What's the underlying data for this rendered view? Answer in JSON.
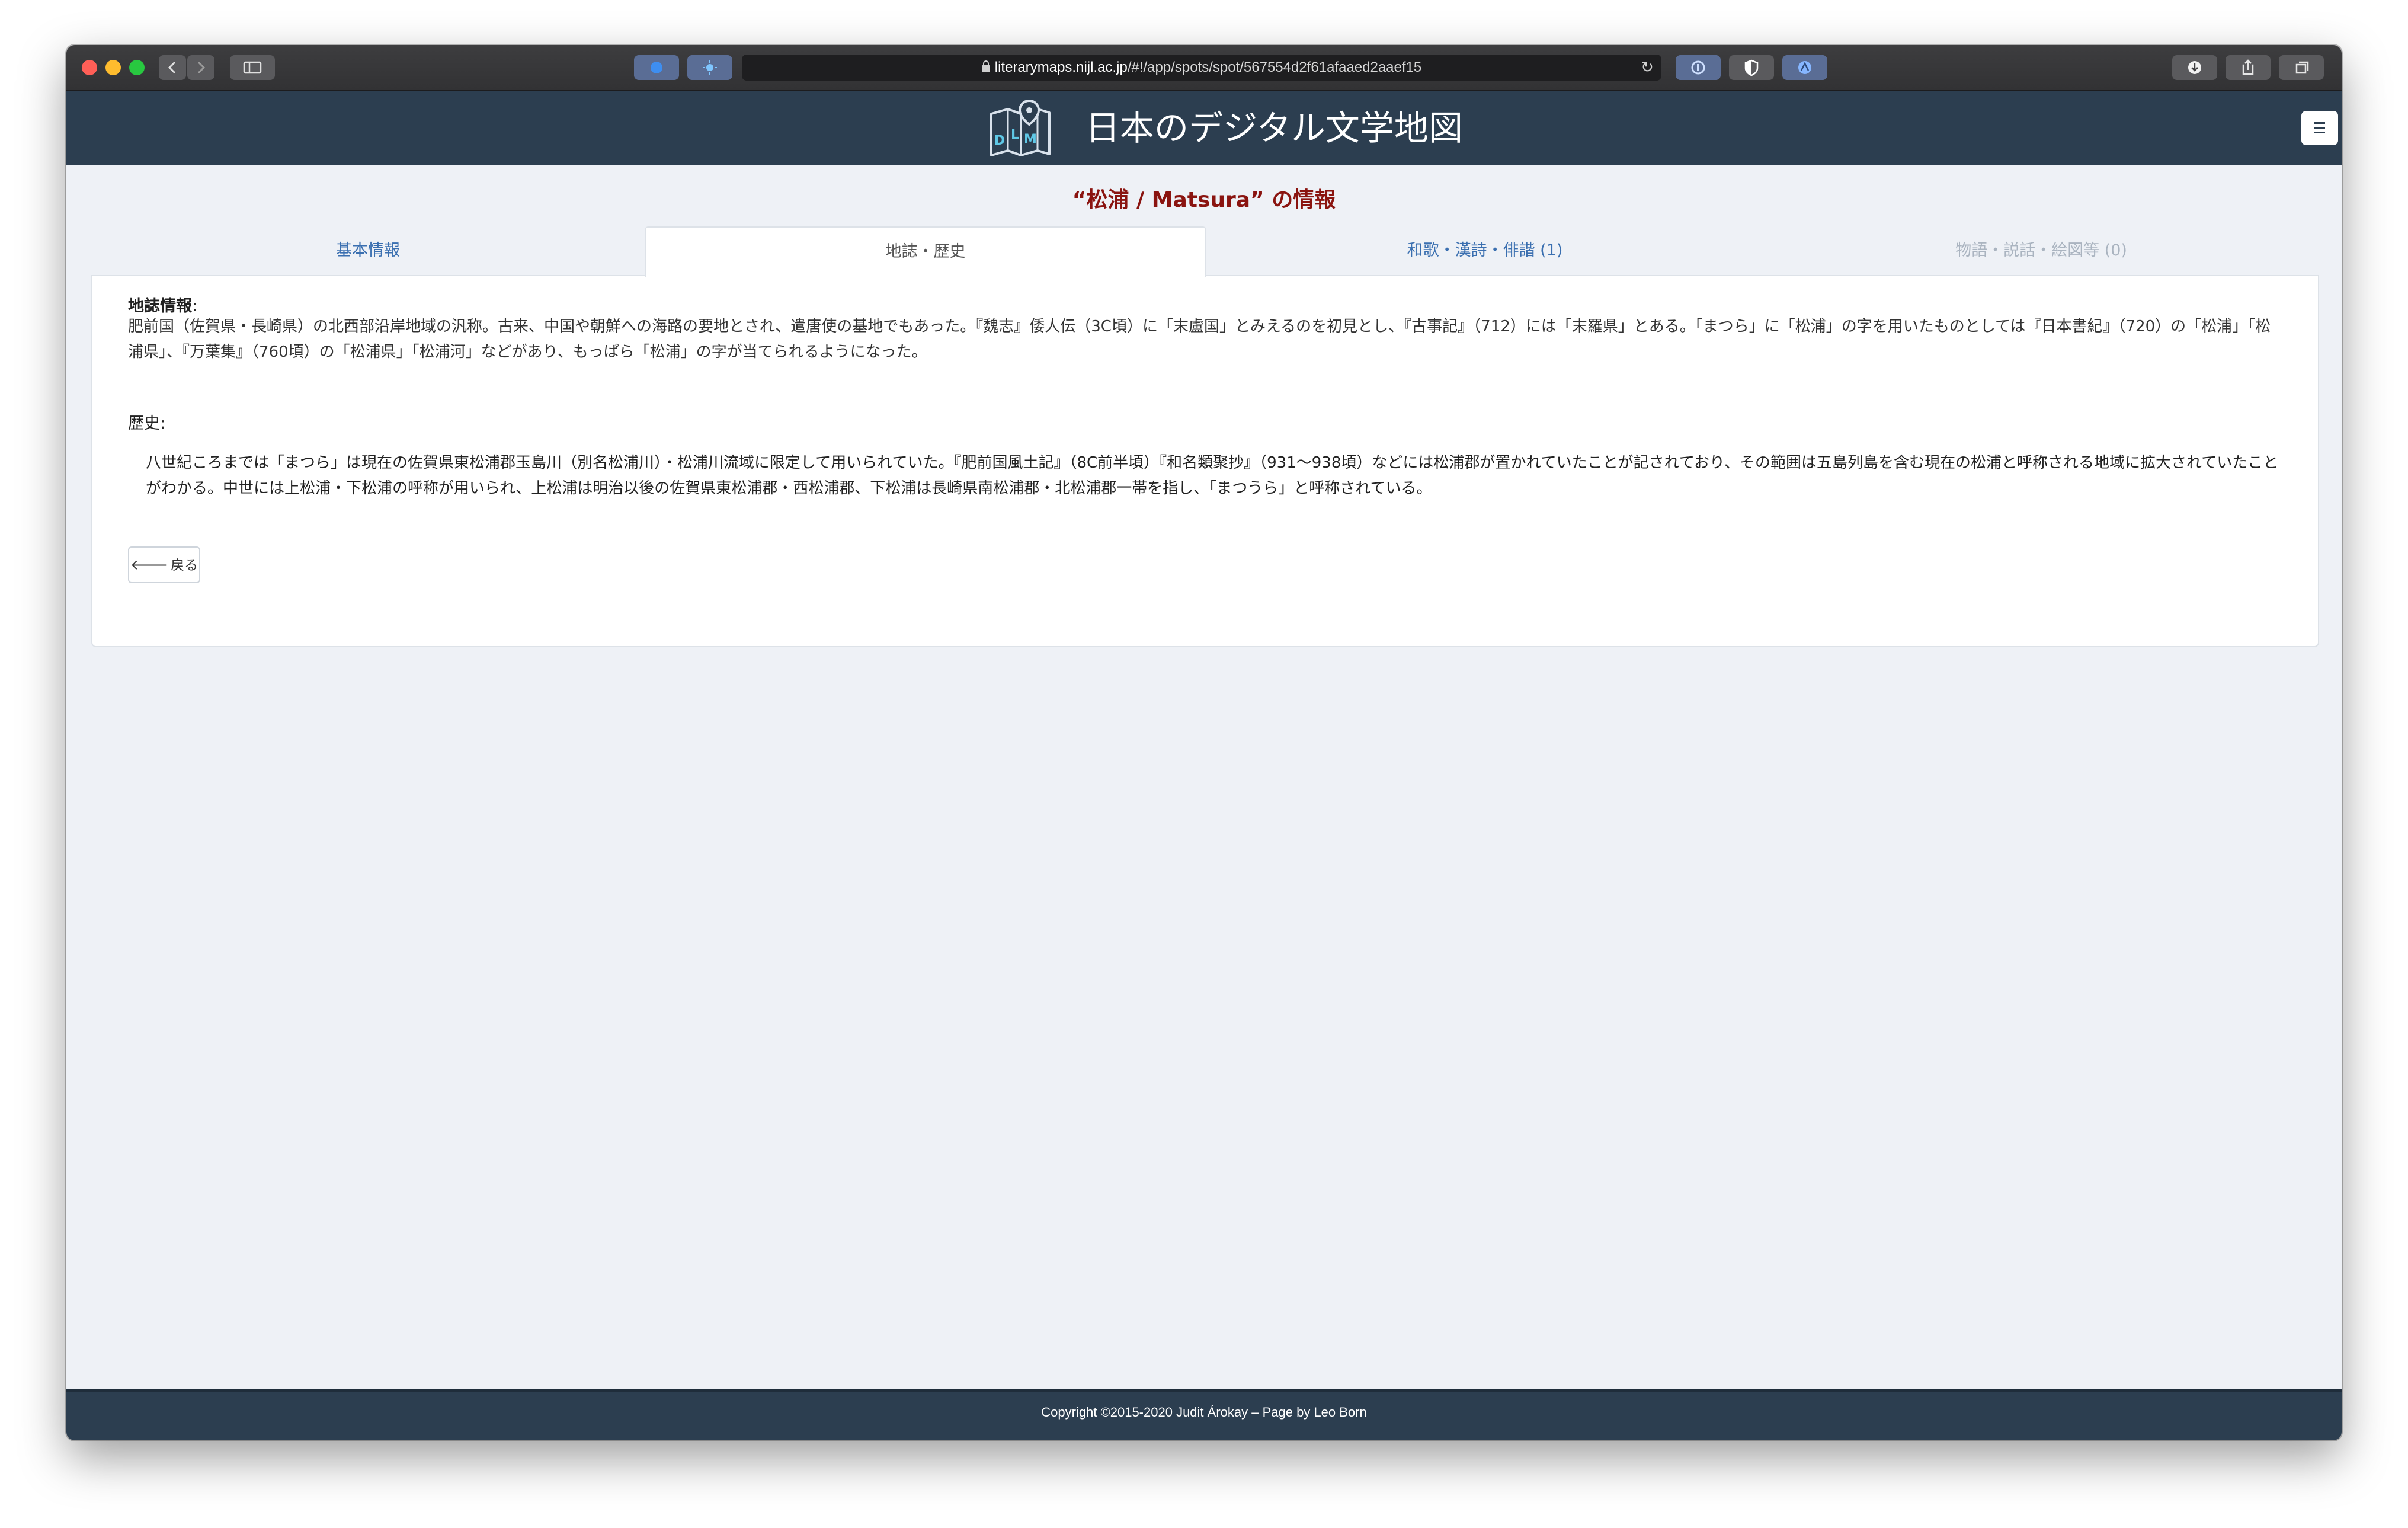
{
  "browser": {
    "url_host": "literarymaps.nijl.ac.jp",
    "url_path": "/#!/app/spots/spot/567554d2f61afaaed2aaef15",
    "reload_glyph": "↻"
  },
  "site": {
    "logo_letters": [
      "D",
      "L",
      "M"
    ],
    "title": "日本のデジタル文学地図",
    "menu_label": "≡"
  },
  "page": {
    "heading": "“松浦 / Matsura” の情報",
    "tabs": [
      {
        "label": "基本情報",
        "state": "link"
      },
      {
        "label": "地誌・歴史",
        "state": "active"
      },
      {
        "label": "和歌・漢詩・俳諧 (1)",
        "state": "link"
      },
      {
        "label": "物語・説話・絵図等 (0)",
        "state": "disabled"
      }
    ]
  },
  "content": {
    "chishi_label": "地誌情報",
    "chishi_colon": ":",
    "chishi_text": "肥前国（佐賀県・長崎県）の北西部沿岸地域の汎称。古来、中国や朝鮮への海路の要地とされ、遣唐使の基地でもあった。『魏志』倭人伝（3C頃）に「末盧国」とみえるのを初見とし、『古事記』（712）には「末羅県」とある。「まつら」に「松浦」の字を用いたものとしては『日本書紀』（720）の「松浦」「松浦県」、『万葉集』（760頃）の「松浦県」「松浦河」などがあり、もっぱら「松浦」の字が当てられるようになった。",
    "rekishi_label": "歴史",
    "rekishi_colon": ":",
    "rekishi_text": "八世紀ころまでは「まつら」は現在の佐賀県東松浦郡玉島川（別名松浦川）・松浦川流域に限定して用いられていた。『肥前国風土記』（8C前半頃）『和名類聚抄』（931～938頃）などには松浦郡が置かれていたことが記されており、その範囲は五島列島を含む現在の松浦と呼称される地域に拡大されていたことがわかる。中世には上松浦・下松浦の呼称が用いられ、上松浦は明治以後の佐賀県東松浦郡・西松浦郡、下松浦は長崎県南松浦郡・北松浦郡一帯を指し、「まつうら」と呼称されている。",
    "back_label": "戻る",
    "back_arrow": "🡐"
  },
  "footer": {
    "copyright": "Copyright ©2015-2020 Judit Árokay – Page by Leo Born"
  },
  "colors": {
    "header_bg": "#2c3e50",
    "heading_red": "#8a1410",
    "tab_link": "#3a6fb0",
    "tab_disabled": "#aab4c0",
    "page_bg": "#eef1f6"
  }
}
